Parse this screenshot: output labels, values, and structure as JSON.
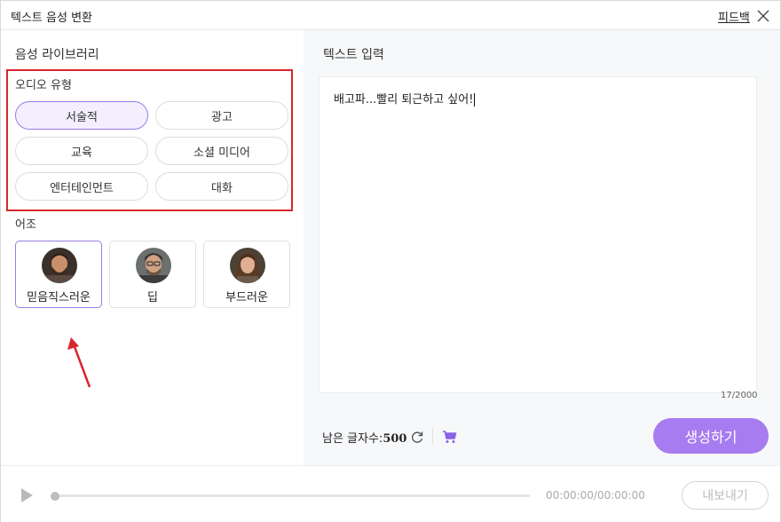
{
  "window": {
    "title": "텍스트 음성 변환",
    "feedback_label": "피드백"
  },
  "voice_library": {
    "title": "음성 라이브러리",
    "audio_type_label": "오디오 유형",
    "audio_types": [
      "서술적",
      "광고",
      "교육",
      "소셜 미디어",
      "엔터테인먼트",
      "대화"
    ],
    "selected_audio_type": "서술적",
    "tone_label": "어조",
    "tones": [
      "믿음직스러운",
      "딥",
      "부드러운"
    ],
    "selected_tone": "믿음직스러운"
  },
  "text_input": {
    "title": "텍스트 입력",
    "value": "배고파...빨리 퇴근하고 싶어!",
    "counter": "17/2000",
    "remaining_label": "남은 글자수:",
    "remaining_value": "500",
    "generate_label": "생성하기"
  },
  "player": {
    "time": "00:00:00/00:00:00",
    "export_label": "내보내기",
    "progress": 0
  },
  "colors": {
    "accent": "#a77cf0",
    "selected_bg": "#f3efff",
    "selected_border": "#9b7de6",
    "annotation": "#d9262c"
  }
}
